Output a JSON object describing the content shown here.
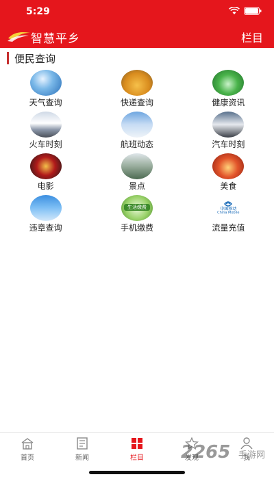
{
  "status_bar": {
    "time": "5:29"
  },
  "app_bar": {
    "title": "智慧平乡",
    "menu_label": "栏目"
  },
  "section": {
    "title": "便民查询"
  },
  "grid": {
    "rows": [
      [
        {
          "label": "天气查询",
          "icon": "weather-icon"
        },
        {
          "label": "快递查询",
          "icon": "express-delivery-icon"
        },
        {
          "label": "健康资讯",
          "icon": "health-info-icon"
        }
      ],
      [
        {
          "label": "火车时刻",
          "icon": "train-icon"
        },
        {
          "label": "航班动态",
          "icon": "flight-icon"
        },
        {
          "label": "汽车时刻",
          "icon": "bus-icon"
        }
      ],
      [
        {
          "label": "电影",
          "icon": "movie-icon"
        },
        {
          "label": "景点",
          "icon": "scenic-spot-icon"
        },
        {
          "label": "美食",
          "icon": "food-icon"
        }
      ],
      [
        {
          "label": "违章查询",
          "icon": "traffic-camera-icon"
        },
        {
          "label": "手机缴费",
          "icon": "phone-payment-icon",
          "icon_text": "生活缴费"
        },
        {
          "label": "流量充值",
          "icon": "china-mobile-icon",
          "icon_text_cn": "中国移动",
          "icon_text_en": "China Mobile"
        }
      ]
    ]
  },
  "tabbar": {
    "items": [
      {
        "label": "首页",
        "icon": "home-icon"
      },
      {
        "label": "新闻",
        "icon": "news-icon"
      },
      {
        "label": "栏目",
        "icon": "columns-icon",
        "active": true
      },
      {
        "label": "发现",
        "icon": "discover-icon"
      },
      {
        "label": "我",
        "icon": "user-icon"
      }
    ]
  },
  "watermark": {
    "number": "2265",
    "site": "手游网"
  },
  "colors": {
    "brand_red": "#e5161c",
    "section_bar": "#c62f2f"
  }
}
